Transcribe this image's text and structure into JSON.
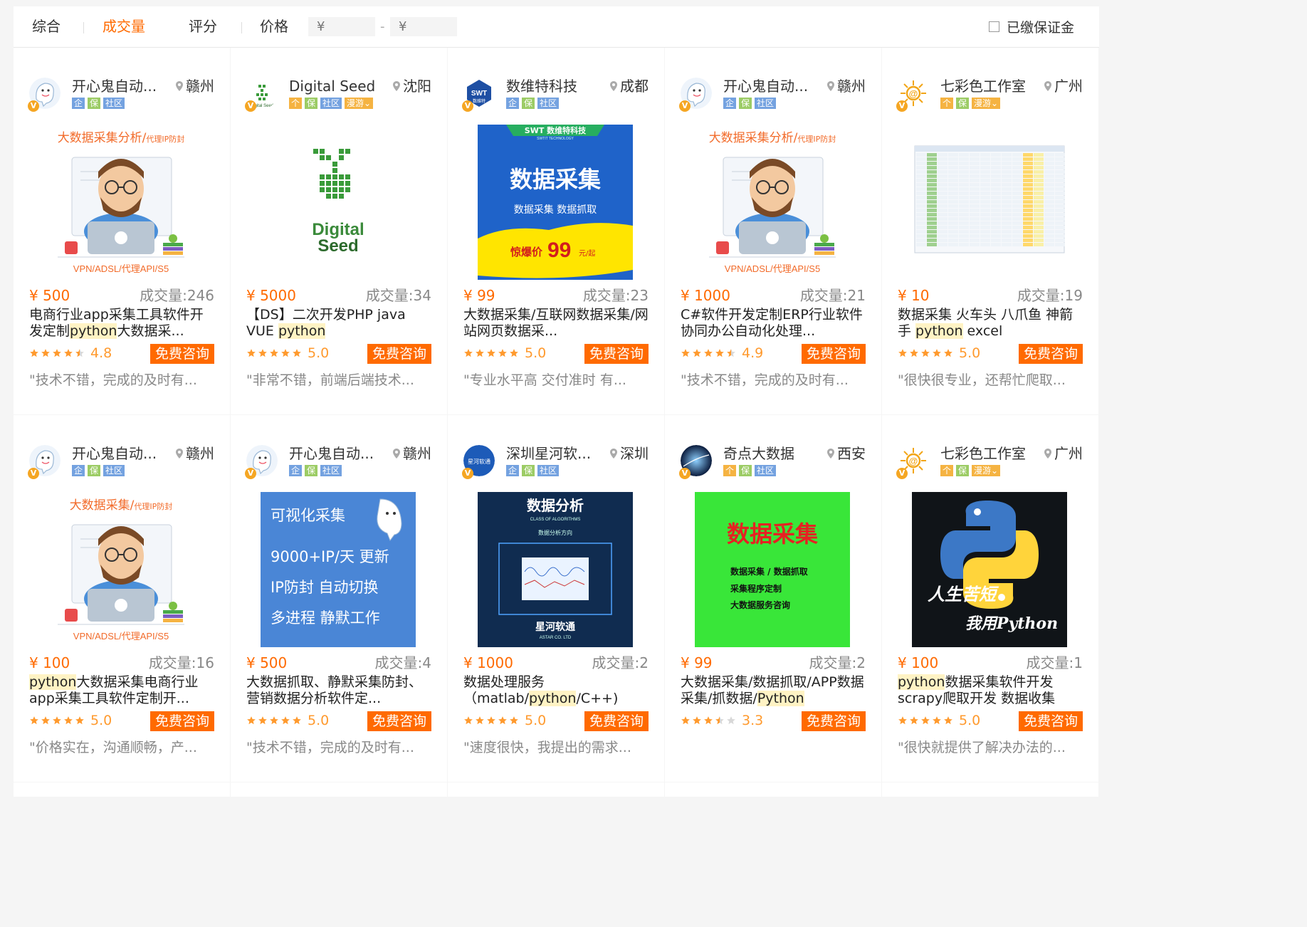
{
  "filters": {
    "sort_tabs": [
      "综合",
      "成交量",
      "评分",
      "价格"
    ],
    "active_sort": "成交量",
    "price_min_placeholder": "¥",
    "price_max_placeholder": "¥",
    "dash": "-",
    "deposit_label": "已缴保证金"
  },
  "cards": [
    {
      "shop": "开心鬼自动...",
      "city": "赣州",
      "tags": [
        "企",
        "保",
        "社区"
      ],
      "price": "¥ 500",
      "sales": "成交量:246",
      "title_parts": [
        "电商行业app采集工具软件开发定制",
        "python",
        "大数据采..."
      ],
      "rating": "4.8",
      "stars": 4.5,
      "consult": "免费咨询",
      "review": "\"技术不错，完成的及时有...",
      "logo": "ghost",
      "img": "hacker1"
    },
    {
      "shop": "Digital Seed",
      "city": "沈阳",
      "tags": [
        "个",
        "保",
        "社区",
        "漫游⌄"
      ],
      "price": "¥ 5000",
      "sales": "成交量:34",
      "title_parts": [
        "【DS】二次开发PHP java VUE ",
        "python",
        ""
      ],
      "rating": "5.0",
      "stars": 5,
      "consult": "免费咨询",
      "review": "\"非常不错，前端后端技术...",
      "logo": "seed",
      "img": "seed"
    },
    {
      "shop": "数维特科技",
      "city": "成都",
      "tags": [
        "企",
        "保",
        "社区"
      ],
      "price": "¥ 99",
      "sales": "成交量:23",
      "title_parts": [
        "大数据采集/互联网数据采集/网站网页数据采...",
        "",
        ""
      ],
      "rating": "5.0",
      "stars": 5,
      "consult": "免费咨询",
      "review": "\"专业水平高 交付准时 有...",
      "logo": "swt",
      "img": "swt"
    },
    {
      "shop": "开心鬼自动...",
      "city": "赣州",
      "tags": [
        "企",
        "保",
        "社区"
      ],
      "price": "¥ 1000",
      "sales": "成交量:21",
      "title_parts": [
        "C#软件开发定制ERP行业软件协同办公自动化处理...",
        "",
        ""
      ],
      "rating": "4.9",
      "stars": 4.5,
      "consult": "免费咨询",
      "review": "\"技术不错，完成的及时有...",
      "logo": "ghost",
      "img": "hacker1"
    },
    {
      "shop": "七彩色工作室",
      "city": "广州",
      "tags": [
        "个",
        "保",
        "漫游⌄"
      ],
      "price": "¥ 10",
      "sales": "成交量:19",
      "title_parts": [
        "数据采集 火车头 八爪鱼 神箭手 ",
        "python",
        " excel"
      ],
      "rating": "5.0",
      "stars": 5,
      "consult": "免费咨询",
      "review": "\"很快很专业，还帮忙爬取...",
      "logo": "sun",
      "img": "sheet"
    },
    {
      "shop": "开心鬼自动...",
      "city": "赣州",
      "tags": [
        "企",
        "保",
        "社区"
      ],
      "price": "¥ 100",
      "sales": "成交量:16",
      "title_parts": [
        "",
        "python",
        "大数据采集电商行业app采集工具软件定制开..."
      ],
      "rating": "5.0",
      "stars": 5,
      "consult": "免费咨询",
      "review": "\"价格实在，沟通顺畅，产...",
      "logo": "ghost",
      "img": "hacker2"
    },
    {
      "shop": "开心鬼自动...",
      "city": "赣州",
      "tags": [
        "企",
        "保",
        "社区"
      ],
      "price": "¥ 500",
      "sales": "成交量:4",
      "title_parts": [
        "大数据抓取、静默采集防封、营销数据分析软件定...",
        "",
        ""
      ],
      "rating": "5.0",
      "stars": 5,
      "consult": "免费咨询",
      "review": "\"技术不错，完成的及时有...",
      "logo": "ghost",
      "img": "visual"
    },
    {
      "shop": "深圳星河软...",
      "city": "深圳",
      "tags": [
        "企",
        "保",
        "社区"
      ],
      "price": "¥ 1000",
      "sales": "成交量:2",
      "title_parts": [
        "数据处理服务（matlab/",
        "python",
        "/C++)"
      ],
      "rating": "5.0",
      "stars": 5,
      "consult": "免费咨询",
      "review": "\"速度很快，我提出的需求...",
      "logo": "xinghe",
      "img": "analysis"
    },
    {
      "shop": "奇点大数据",
      "city": "西安",
      "tags": [
        "个",
        "保",
        "社区"
      ],
      "price": "¥ 99",
      "sales": "成交量:2",
      "title_parts": [
        "大数据采集/数据抓取/APP数据采集/抓数据/",
        "Python",
        ""
      ],
      "rating": "3.3",
      "stars": 3.5,
      "consult": "免费咨询",
      "review": "",
      "logo": "qidian",
      "img": "green"
    },
    {
      "shop": "七彩色工作室",
      "city": "广州",
      "tags": [
        "个",
        "保",
        "漫游⌄"
      ],
      "price": "¥ 100",
      "sales": "成交量:1",
      "title_parts": [
        "",
        "python",
        "数据采集软件开发scrapy爬取开发 数据收集"
      ],
      "rating": "5.0",
      "stars": 5,
      "consult": "免费咨询",
      "review": "\"很快就提供了解决办法的...",
      "logo": "sun",
      "img": "pylogo"
    }
  ],
  "images": {
    "hacker1": {
      "top": "大数据采集分析/",
      "top_small": "代理IP防封",
      "bottom": "VPN/ADSL/代理API/S5"
    },
    "hacker2": {
      "top": "大数据采集/",
      "top_small": "代理IP防封",
      "bottom": "VPN/ADSL/代理API/S5"
    },
    "seed": {
      "line1": "Digital",
      "line2": "Seed"
    },
    "swt": {
      "brand": "SWT 数维特科技",
      "sub": "SWTIT TECHNOLOGY",
      "title": "数据采集",
      "items": "数据采集    数据抓取",
      "promo": "惊爆价",
      "promo_num": "99",
      "promo_unit": "元/起"
    },
    "visual": {
      "title": "可视化采集",
      "l1": "9000+IP/天 更新",
      "l2": "IP防封  自动切换",
      "l3": "多进程  静默工作"
    },
    "analysis": {
      "title": "数据分析",
      "sub": "CLASS OF ALGORITHMS",
      "sub2": "数据分析方向",
      "brand": "星河软通",
      "brand_en": "ASTAR CO. LTD"
    },
    "green": {
      "title": "数据采集",
      "l1": "数据采集 / 数据抓取",
      "l2": "采集程序定制",
      "l3": "大数据服务咨询"
    },
    "pylogo": {
      "l1": "人生苦短",
      "l2": "我用Python"
    },
    "swt_logo": {
      "text": "SWT",
      "sub": "数维特"
    },
    "xinghe_logo": {
      "text": "星河软通"
    },
    "seed_logo": {
      "text": "Digital Seed"
    }
  },
  "colors": {
    "accent": "#ff6a00",
    "star": "#ff9a2e",
    "tag_blue": "#74a2e0",
    "tag_green": "#9ccc65",
    "tag_orange": "#f5b342"
  }
}
